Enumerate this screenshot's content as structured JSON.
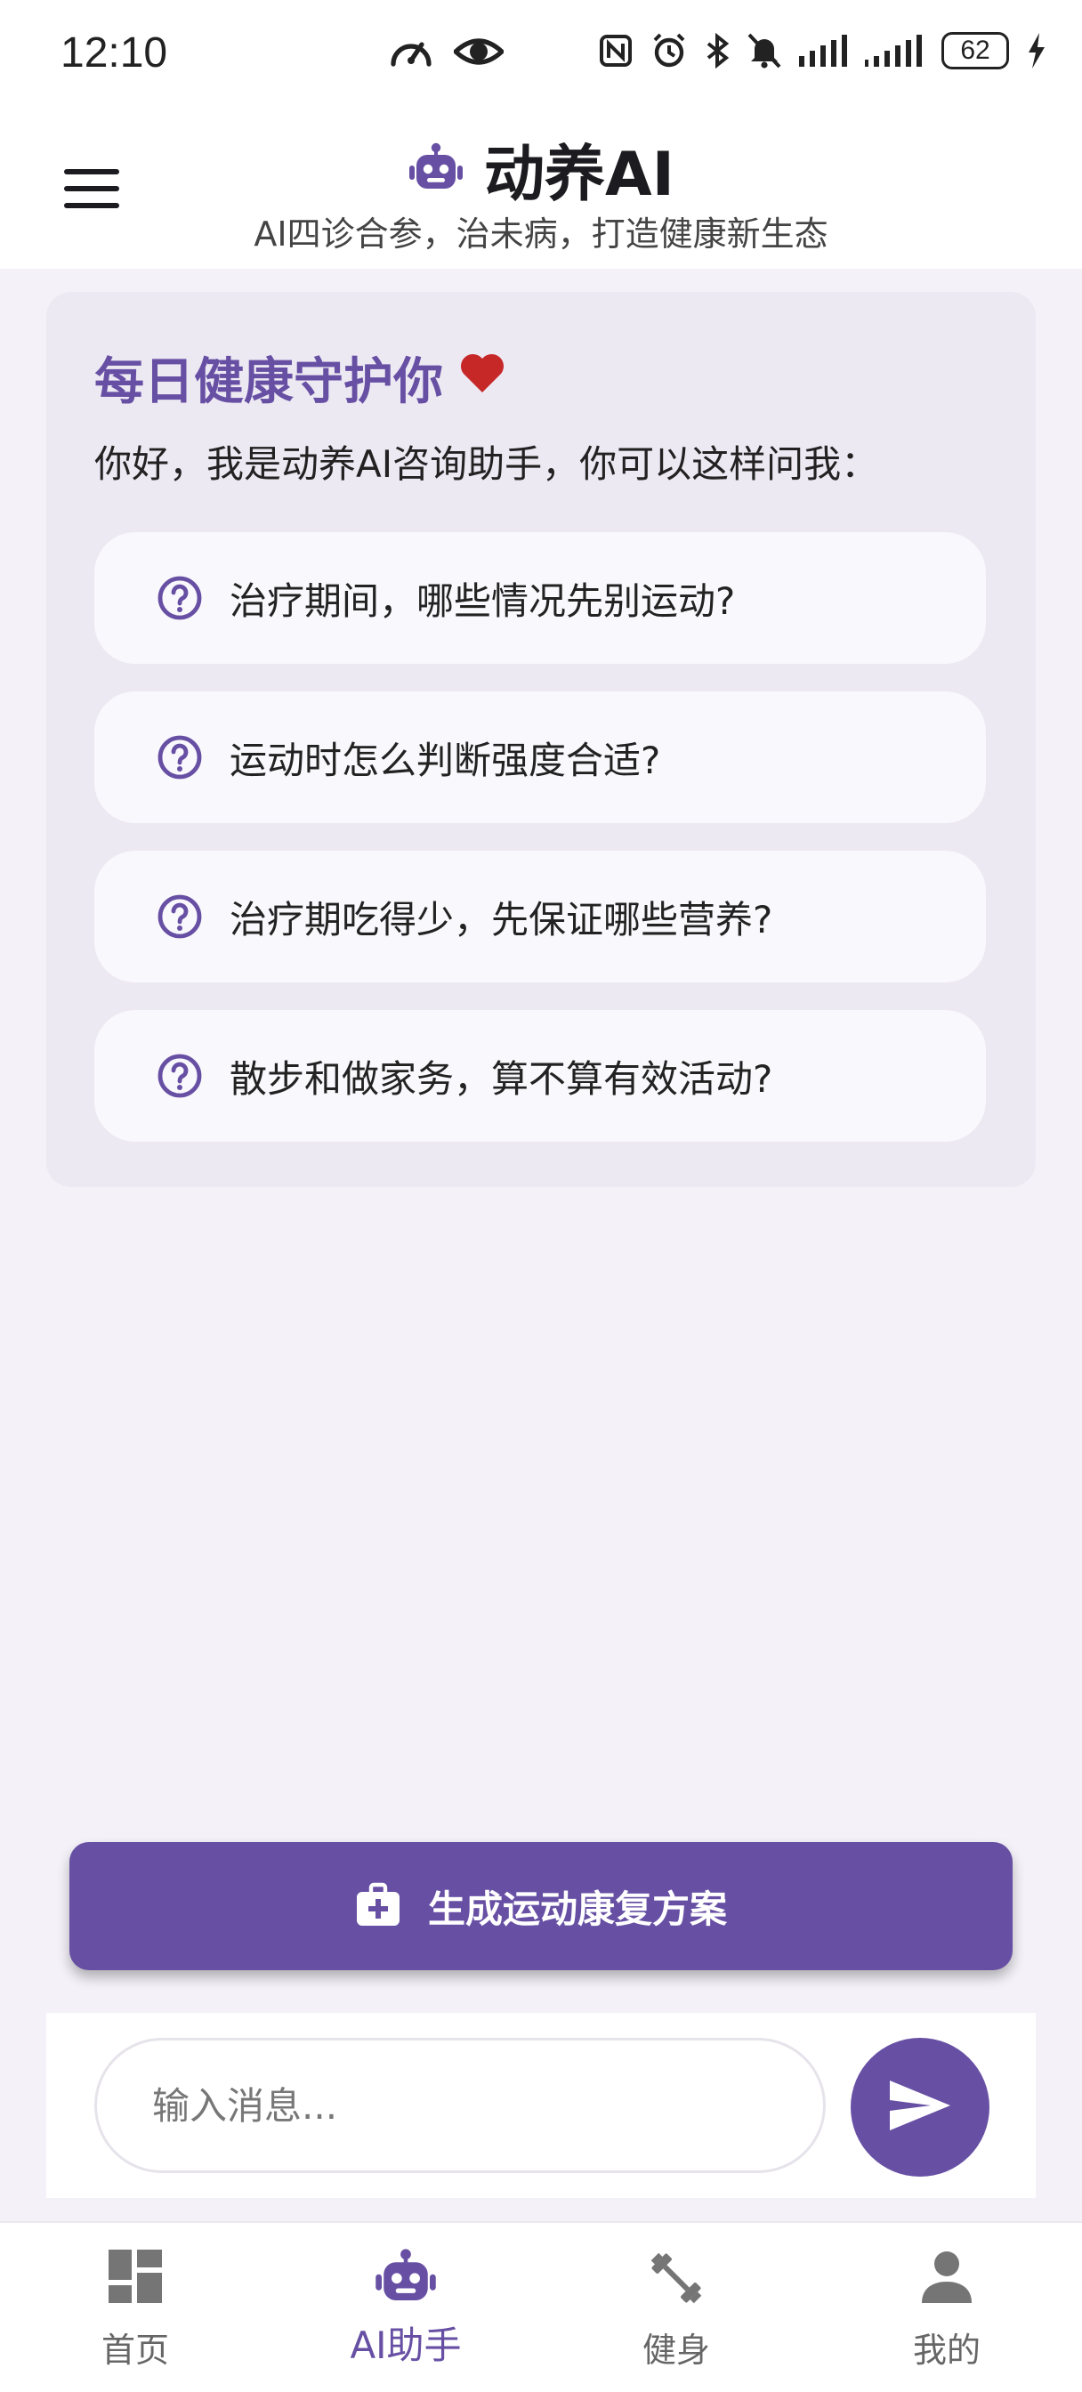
{
  "status_bar": {
    "time": "12:10",
    "battery": "62",
    "icons": [
      "speedometer-icon",
      "eye-icon",
      "nfc-icon",
      "alarm-icon",
      "bluetooth-icon",
      "mute-icon",
      "signal-icon",
      "signal-icon",
      "battery-icon",
      "charging-icon"
    ]
  },
  "header": {
    "title": "动养AI",
    "subtitle": "AI四诊合参，治未病，打造健康新生态",
    "menu_icon": "menu-icon",
    "logo_icon": "robot-icon"
  },
  "welcome": {
    "title": "每日健康守护你",
    "title_icon": "heart-icon",
    "greeting": "你好，我是动养AI咨询助手，你可以这样问我：",
    "questions": [
      {
        "text": "治疗期间，哪些情况先别运动?",
        "icon": "help-circle-icon"
      },
      {
        "text": "运动时怎么判断强度合适?",
        "icon": "help-circle-icon"
      },
      {
        "text": "治疗期吃得少，先保证哪些营养?",
        "icon": "help-circle-icon"
      },
      {
        "text": "散步和做家务，算不算有效活动?",
        "icon": "help-circle-icon"
      }
    ]
  },
  "generate_button": {
    "label": "生成运动康复方案",
    "icon": "medical-bag-icon"
  },
  "composer": {
    "placeholder": "输入消息...",
    "send_icon": "send-icon"
  },
  "bottom_nav": {
    "items": [
      {
        "label": "首页",
        "icon": "dashboard-icon",
        "active": false
      },
      {
        "label": "AI助手",
        "icon": "robot-icon",
        "active": true
      },
      {
        "label": "健身",
        "icon": "dumbbell-icon",
        "active": false
      },
      {
        "label": "我的",
        "icon": "person-icon",
        "active": false
      }
    ]
  },
  "colors": {
    "accent": "#6750a4",
    "heart": "#c62828",
    "background": "#f4f2f8",
    "card": "#ede9f3"
  }
}
